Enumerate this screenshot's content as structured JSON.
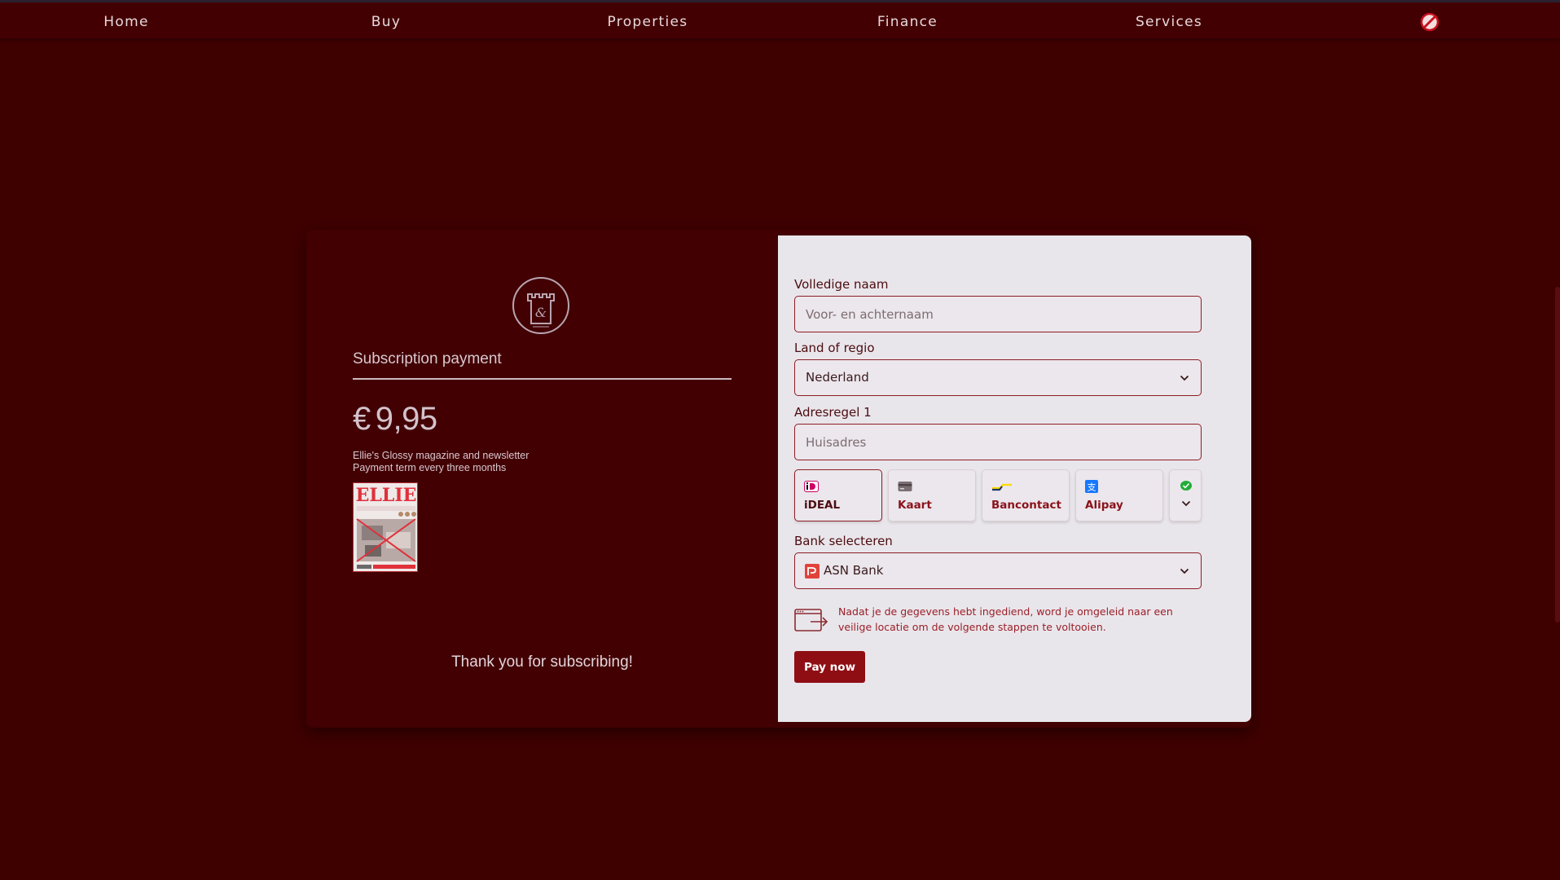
{
  "nav": {
    "items": [
      "Home",
      "Buy",
      "Properties",
      "Finance",
      "Services"
    ]
  },
  "left": {
    "title": "Subscription payment",
    "currency": "€",
    "amount": "9,95",
    "description_line1": "Ellie's Glossy magazine and newsletter",
    "description_line2": "Payment term every three months",
    "thanks": "Thank you for subscribing!",
    "cover_brand": "ELLIE"
  },
  "form": {
    "name_label": "Volledige naam",
    "name_placeholder": "Voor- en achternaam",
    "country_label": "Land of regio",
    "country_value": "Nederland",
    "address_label": "Adresregel 1",
    "address_placeholder": "Huisadres",
    "methods": [
      {
        "label": "iDEAL",
        "icon": "ideal-icon",
        "active": true
      },
      {
        "label": "Kaart",
        "icon": "card-icon",
        "active": false
      },
      {
        "label": "Bancontact",
        "icon": "bancontact-icon",
        "active": false
      },
      {
        "label": "Alipay",
        "icon": "alipay-icon",
        "active": false
      }
    ],
    "bank_label": "Bank selecteren",
    "bank_value": "ASN Bank",
    "info_text": "Nadat je de gegevens hebt ingediend, word je omgeleid naar een veilige locatie om de volgende stappen te voltooien.",
    "pay_label": "Pay now"
  },
  "colors": {
    "background": "#3f0000",
    "accent": "#8f0e14",
    "form_bg": "#e9e6eb"
  }
}
